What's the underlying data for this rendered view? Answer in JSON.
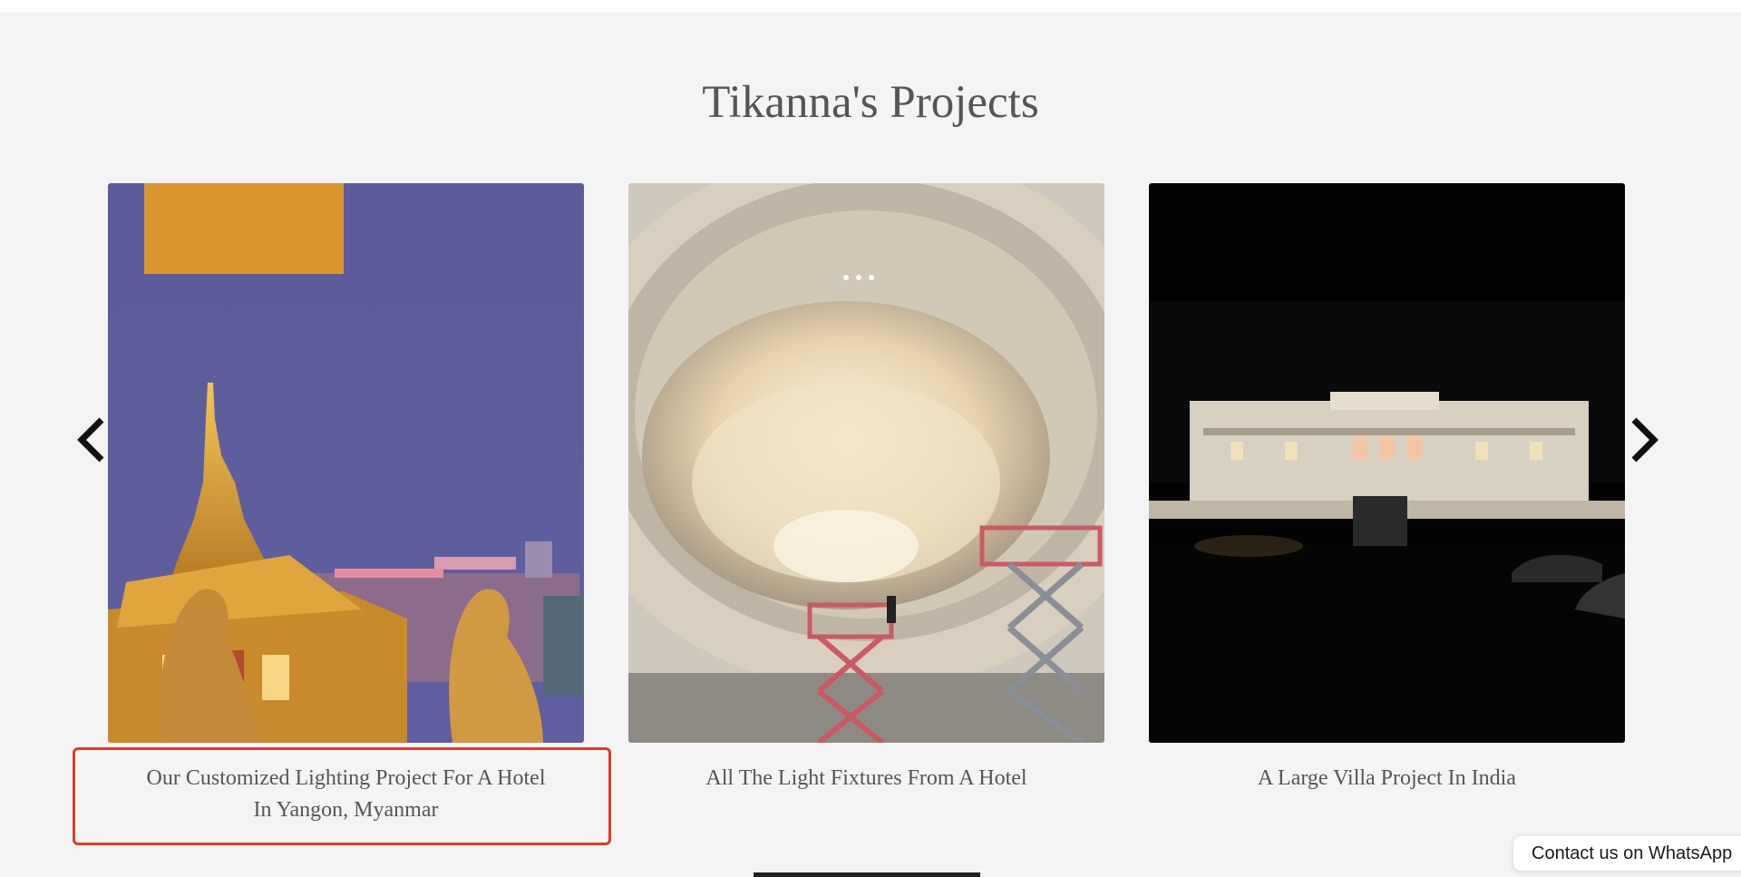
{
  "page": {
    "title": "Tikanna's Projects"
  },
  "carousel": {
    "prev_icon": "chevron-left-icon",
    "next_icon": "chevron-right-icon",
    "items": [
      {
        "caption": "Our Customized Lighting Project For A Hotel In Yangon, Myanmar"
      },
      {
        "caption": "All The Light Fixtures From A Hotel"
      },
      {
        "caption": "A Large Villa Project In India"
      }
    ]
  },
  "whatsapp": {
    "label": "Contact us on WhatsApp"
  },
  "colors": {
    "background": "#f4f4f4",
    "text": "#555555",
    "highlight": "#e03a2b"
  }
}
